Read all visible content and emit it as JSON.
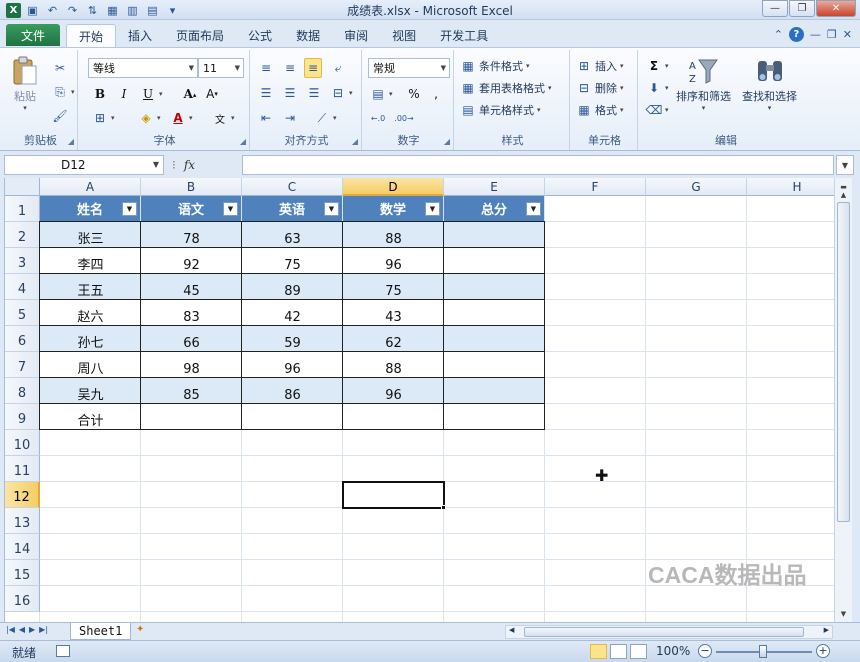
{
  "window": {
    "title": "成绩表.xlsx - Microsoft Excel"
  },
  "tabs": {
    "file": "文件",
    "items": [
      "开始",
      "插入",
      "页面布局",
      "公式",
      "数据",
      "审阅",
      "视图",
      "开发工具"
    ],
    "active": "开始"
  },
  "ribbon": {
    "clipboard": {
      "label": "剪贴板",
      "paste": "粘贴"
    },
    "font": {
      "label": "字体",
      "name": "等线",
      "size": "11"
    },
    "alignment": {
      "label": "对齐方式"
    },
    "number": {
      "label": "数字",
      "format": "常规",
      "percent": "%"
    },
    "styles": {
      "label": "样式",
      "conditional": "条件格式",
      "table": "套用表格格式",
      "cell": "单元格样式"
    },
    "cells": {
      "label": "单元格",
      "insert": "插入",
      "delete": "删除",
      "format": "格式"
    },
    "editing": {
      "label": "编辑",
      "sort": "排序和筛选",
      "find": "查找和选择"
    }
  },
  "formula_bar": {
    "name_box": "D12",
    "fx": "fx",
    "value": ""
  },
  "grid": {
    "columns": [
      "A",
      "B",
      "C",
      "D",
      "E",
      "F",
      "G",
      "H"
    ],
    "selected_column": "D",
    "rows": [
      "1",
      "2",
      "3",
      "4",
      "5",
      "6",
      "7",
      "8",
      "9",
      "10",
      "11",
      "12",
      "13",
      "14",
      "15",
      "16"
    ],
    "selected_row": "12",
    "active_cell": "D12",
    "table": {
      "headers": [
        "姓名",
        "语文",
        "英语",
        "数学",
        "总分"
      ],
      "rows": [
        [
          "张三",
          "78",
          "63",
          "88",
          ""
        ],
        [
          "李四",
          "92",
          "75",
          "96",
          ""
        ],
        [
          "王五",
          "45",
          "89",
          "75",
          ""
        ],
        [
          "赵六",
          "83",
          "42",
          "43",
          ""
        ],
        [
          "孙七",
          "66",
          "59",
          "62",
          ""
        ],
        [
          "周八",
          "98",
          "96",
          "88",
          ""
        ],
        [
          "吴九",
          "85",
          "86",
          "96",
          ""
        ]
      ],
      "total_row": [
        "合计",
        "",
        "",
        "",
        ""
      ],
      "header_color": "#4f81bd",
      "band_color": "#dce9f6"
    },
    "watermark": "CACA数据出品"
  },
  "sheets": {
    "items": [
      "Sheet1"
    ],
    "active": "Sheet1"
  },
  "status": {
    "ready": "就绪",
    "zoom": "100%"
  }
}
